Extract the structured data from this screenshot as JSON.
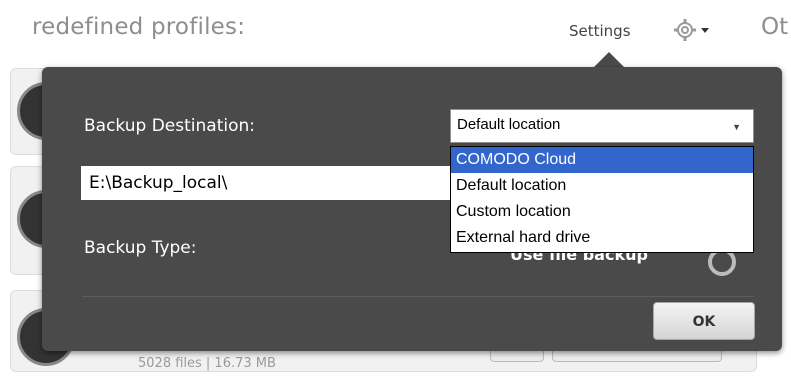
{
  "header": {
    "title": "redefined profiles:",
    "settings_label": "Settings",
    "gear_icon": "gear-icon",
    "other_label": "Ot"
  },
  "background": {
    "row_meta": "5028 files | 16.73 MB"
  },
  "popup": {
    "backup_destination_label": "Backup Destination:",
    "destination_path": "E:\\Backup_local\\",
    "backup_type_label": "Backup Type:",
    "select": {
      "value": "Default location",
      "options": [
        "COMODO Cloud",
        "Default location",
        "Custom location",
        "External hard drive"
      ],
      "highlighted": "COMODO Cloud"
    },
    "partially_hidden_type": "Use file backup",
    "ok_label": "OK"
  },
  "colors": {
    "popup_bg": "#4a4a4a",
    "highlight": "#3366cc"
  }
}
